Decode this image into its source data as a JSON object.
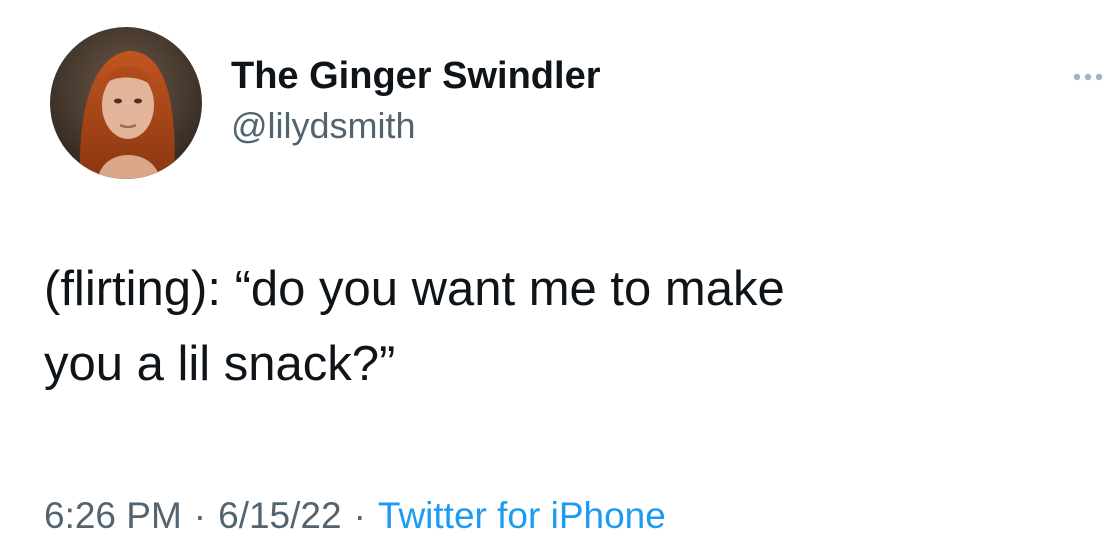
{
  "tweet": {
    "author": {
      "display_name": "The Ginger Swindler",
      "handle": "@lilydsmith",
      "avatar_icon": "profile-photo"
    },
    "more_icon": "more-options-icon",
    "text": "(flirting): “do you want me to make\nyou a lil snack?”",
    "meta": {
      "time": "6:26 PM",
      "separator": "·",
      "date": "6/15/22",
      "source": "Twitter for iPhone"
    }
  },
  "colors": {
    "text_primary": "#0f1419",
    "text_secondary": "#536471",
    "link": "#1d9bf0",
    "background": "#ffffff"
  }
}
